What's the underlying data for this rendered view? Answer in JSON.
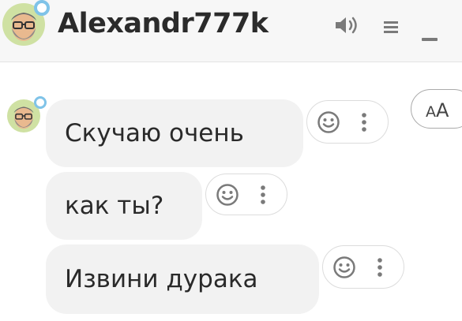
{
  "header": {
    "username": "Alexandr777k",
    "icons": [
      "speaker-icon",
      "menu-icon",
      "minimize-icon"
    ]
  },
  "font_toggle": {
    "small": "A",
    "large": "A"
  },
  "messages": [
    {
      "text": "Скучаю очень"
    },
    {
      "text": "как ты?"
    },
    {
      "text": "Извини дурака"
    }
  ],
  "colors": {
    "header_bg": "#f7f7f7",
    "bubble_bg": "#f2f2f2",
    "status_ring": "#7fc3e8",
    "icon_gray": "#7a7a7a"
  }
}
